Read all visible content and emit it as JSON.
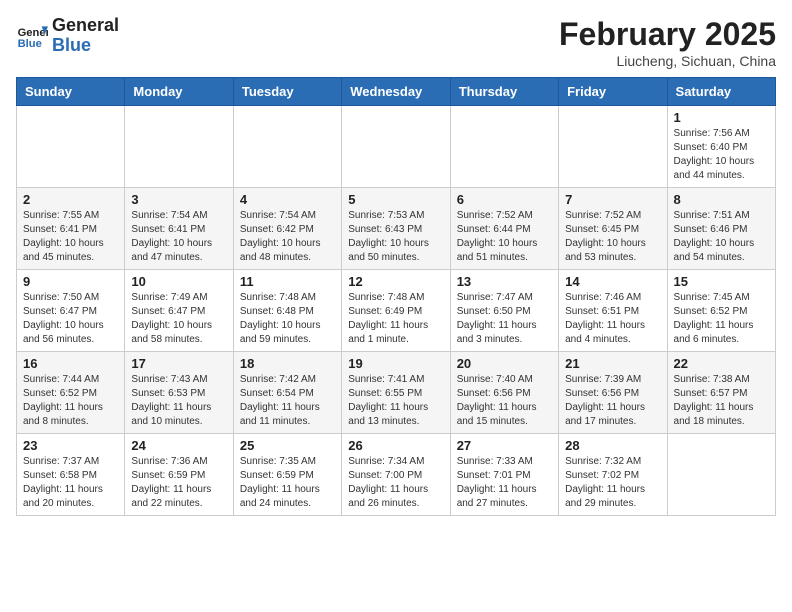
{
  "header": {
    "logo_general": "General",
    "logo_blue": "Blue",
    "month_year": "February 2025",
    "location": "Liucheng, Sichuan, China"
  },
  "days_of_week": [
    "Sunday",
    "Monday",
    "Tuesday",
    "Wednesday",
    "Thursday",
    "Friday",
    "Saturday"
  ],
  "weeks": [
    [
      {
        "day": "",
        "info": ""
      },
      {
        "day": "",
        "info": ""
      },
      {
        "day": "",
        "info": ""
      },
      {
        "day": "",
        "info": ""
      },
      {
        "day": "",
        "info": ""
      },
      {
        "day": "",
        "info": ""
      },
      {
        "day": "1",
        "info": "Sunrise: 7:56 AM\nSunset: 6:40 PM\nDaylight: 10 hours\nand 44 minutes."
      }
    ],
    [
      {
        "day": "2",
        "info": "Sunrise: 7:55 AM\nSunset: 6:41 PM\nDaylight: 10 hours\nand 45 minutes."
      },
      {
        "day": "3",
        "info": "Sunrise: 7:54 AM\nSunset: 6:41 PM\nDaylight: 10 hours\nand 47 minutes."
      },
      {
        "day": "4",
        "info": "Sunrise: 7:54 AM\nSunset: 6:42 PM\nDaylight: 10 hours\nand 48 minutes."
      },
      {
        "day": "5",
        "info": "Sunrise: 7:53 AM\nSunset: 6:43 PM\nDaylight: 10 hours\nand 50 minutes."
      },
      {
        "day": "6",
        "info": "Sunrise: 7:52 AM\nSunset: 6:44 PM\nDaylight: 10 hours\nand 51 minutes."
      },
      {
        "day": "7",
        "info": "Sunrise: 7:52 AM\nSunset: 6:45 PM\nDaylight: 10 hours\nand 53 minutes."
      },
      {
        "day": "8",
        "info": "Sunrise: 7:51 AM\nSunset: 6:46 PM\nDaylight: 10 hours\nand 54 minutes."
      }
    ],
    [
      {
        "day": "9",
        "info": "Sunrise: 7:50 AM\nSunset: 6:47 PM\nDaylight: 10 hours\nand 56 minutes."
      },
      {
        "day": "10",
        "info": "Sunrise: 7:49 AM\nSunset: 6:47 PM\nDaylight: 10 hours\nand 58 minutes."
      },
      {
        "day": "11",
        "info": "Sunrise: 7:48 AM\nSunset: 6:48 PM\nDaylight: 10 hours\nand 59 minutes."
      },
      {
        "day": "12",
        "info": "Sunrise: 7:48 AM\nSunset: 6:49 PM\nDaylight: 11 hours\nand 1 minute."
      },
      {
        "day": "13",
        "info": "Sunrise: 7:47 AM\nSunset: 6:50 PM\nDaylight: 11 hours\nand 3 minutes."
      },
      {
        "day": "14",
        "info": "Sunrise: 7:46 AM\nSunset: 6:51 PM\nDaylight: 11 hours\nand 4 minutes."
      },
      {
        "day": "15",
        "info": "Sunrise: 7:45 AM\nSunset: 6:52 PM\nDaylight: 11 hours\nand 6 minutes."
      }
    ],
    [
      {
        "day": "16",
        "info": "Sunrise: 7:44 AM\nSunset: 6:52 PM\nDaylight: 11 hours\nand 8 minutes."
      },
      {
        "day": "17",
        "info": "Sunrise: 7:43 AM\nSunset: 6:53 PM\nDaylight: 11 hours\nand 10 minutes."
      },
      {
        "day": "18",
        "info": "Sunrise: 7:42 AM\nSunset: 6:54 PM\nDaylight: 11 hours\nand 11 minutes."
      },
      {
        "day": "19",
        "info": "Sunrise: 7:41 AM\nSunset: 6:55 PM\nDaylight: 11 hours\nand 13 minutes."
      },
      {
        "day": "20",
        "info": "Sunrise: 7:40 AM\nSunset: 6:56 PM\nDaylight: 11 hours\nand 15 minutes."
      },
      {
        "day": "21",
        "info": "Sunrise: 7:39 AM\nSunset: 6:56 PM\nDaylight: 11 hours\nand 17 minutes."
      },
      {
        "day": "22",
        "info": "Sunrise: 7:38 AM\nSunset: 6:57 PM\nDaylight: 11 hours\nand 18 minutes."
      }
    ],
    [
      {
        "day": "23",
        "info": "Sunrise: 7:37 AM\nSunset: 6:58 PM\nDaylight: 11 hours\nand 20 minutes."
      },
      {
        "day": "24",
        "info": "Sunrise: 7:36 AM\nSunset: 6:59 PM\nDaylight: 11 hours\nand 22 minutes."
      },
      {
        "day": "25",
        "info": "Sunrise: 7:35 AM\nSunset: 6:59 PM\nDaylight: 11 hours\nand 24 minutes."
      },
      {
        "day": "26",
        "info": "Sunrise: 7:34 AM\nSunset: 7:00 PM\nDaylight: 11 hours\nand 26 minutes."
      },
      {
        "day": "27",
        "info": "Sunrise: 7:33 AM\nSunset: 7:01 PM\nDaylight: 11 hours\nand 27 minutes."
      },
      {
        "day": "28",
        "info": "Sunrise: 7:32 AM\nSunset: 7:02 PM\nDaylight: 11 hours\nand 29 minutes."
      },
      {
        "day": "",
        "info": ""
      }
    ]
  ]
}
